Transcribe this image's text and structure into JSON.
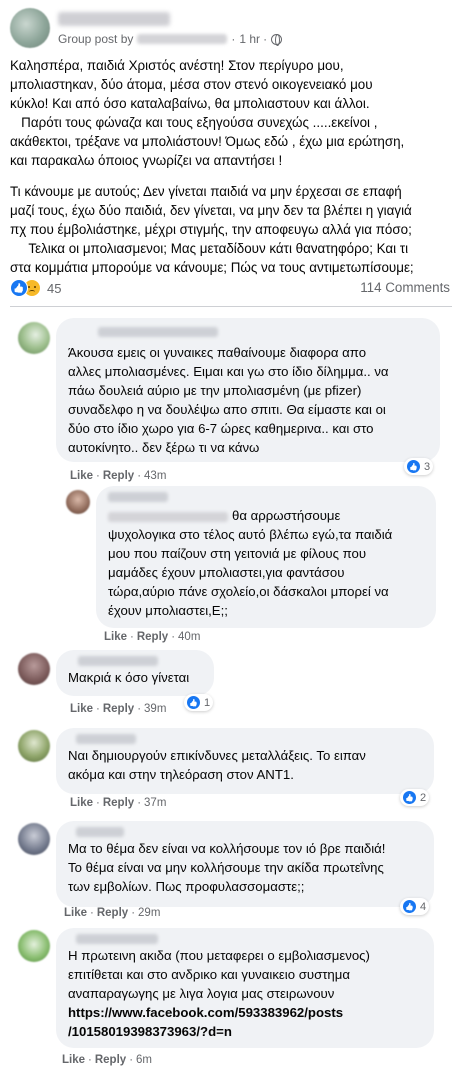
{
  "post": {
    "meta_prefix": "Group post by",
    "time": "1 hr",
    "body_lines": [
      "Καλησπέρα, παιδιά Χριστός ανέστη! Στον περίγυρο μου,",
      "μπολιαστηκαν, δύο άτομα, μέσα στον στενό οικογενειακό μου",
      "κύκλο! Και από όσο καταλαβαίνω, θα μπολιαστουν και άλλοι.",
      "   Παρότι τους φώναζα και τους εξηγούσα συνεχώς .....εκείνοι ,",
      "ακάθεκτοι, τρέξανε να μπολιάστουν!  Όμως εδώ , έχω μια ερώτηση,",
      "και παρακαλω όποιος γνωρίζει να απαντήσει !"
    ],
    "body_lines_2": [
      "Τι κάνουμε με αυτούς; Δεν γίνεται παιδιά να μην έρχεσαι σε επαφή",
      "μαζί τους, έχω δύο παιδιά, δεν γίνεται, να μην δεν τα βλέπει η γιαγιά",
      "πχ που έμβολιάστηκε,  μέχρι στιγμής, την αποφευγω αλλά για πόσο;",
      "     Τελικα οι μπολιασμενοι; Μας μεταδίδουν κάτι θανατηφόρο; Και τι",
      "στα κομμάτια μπορούμε να κάνουμε; Πώς να τους αντιμετωπίσουμε;"
    ],
    "reaction_count": "45",
    "comments_count": "114 Comments"
  },
  "comments": [
    {
      "lines": [
        "Άκουσα εμεις οι γυναικες παθαίνουμε διαφορα απο",
        "αλλες μπολιασμένες. Ειμαι και γω στο ίδιο δίλημμα.. να",
        "πάω δουλειά αύριο με την μπολιασμένη (με pfizer)",
        "συναδελφο η να δουλέψω απο σπιτι. Θα είμαστε και οι",
        "δύο στο ίδιο χωρο για 6-7 ώρες καθημερινα.. και στο",
        "αυτοκίνητο.. δεν ξέρω τι να κάνω"
      ],
      "like": "Like",
      "reply": "Reply",
      "time": "43m",
      "reactions": "3"
    },
    {
      "first_line": "θα αρρωστήσουμε",
      "lines": [
        "ψυχολογικα στο τέλος αυτό βλέπω εγώ,τα παιδιά",
        "μου που παίζουν στη γειτονιά με φίλους που",
        "μαμάδες έχουν μπολιαστει,για φαντάσου",
        "τώρα,αύριο πάνε σχολείο,οι δάσκαλοι μπορεί να",
        "έχουν μπολιαστει,Ε;;"
      ],
      "like": "Like",
      "reply": "Reply",
      "time": "40m"
    },
    {
      "lines": [
        "Μακριά κ όσο γίνεται"
      ],
      "like": "Like",
      "reply": "Reply",
      "time": "39m",
      "reactions": "1"
    },
    {
      "lines": [
        "Ναι δημιουργούν επικίνδυνες μεταλλάξεις. Το ειπαν",
        "ακόμα και στην τηλεόραση στον ΑΝΤ1."
      ],
      "like": "Like",
      "reply": "Reply",
      "time": "37m",
      "reactions": "2"
    },
    {
      "lines": [
        "Μα το θέμα δεν είναι να κολλήσουμε τον ιό βρε παιδιά!",
        "Το θέμα είναι να μην κολλήσουμε την ακίδα πρωτεΐνης",
        "των εμβολίων. Πως προφυλασσομαστε;;"
      ],
      "like": "Like",
      "reply": "Reply",
      "time": "29m",
      "reactions": "4"
    },
    {
      "lines": [
        "Η πρωτεινη ακιδα (που μεταφερει ο εμβολιασμενος)",
        "επιτίθεται και στο ανδρικο και γυναικειο συστημα",
        "αναπαραγωγης με λιγα λογια μας στειρωνουν"
      ],
      "link_lines": [
        "https://www.facebook.com/593383962/posts",
        "/10158019398373963/?d=n"
      ],
      "like": "Like",
      "reply": "Reply",
      "time": "6m"
    }
  ],
  "colors": {
    "like_blue": "#1877f2",
    "sad_yellow": "#f7b928",
    "bubble_bg": "#f0f2f5",
    "meta_gray": "#65676b"
  },
  "icons": [
    "globe-icon",
    "like-reaction-icon",
    "sad-reaction-icon"
  ]
}
